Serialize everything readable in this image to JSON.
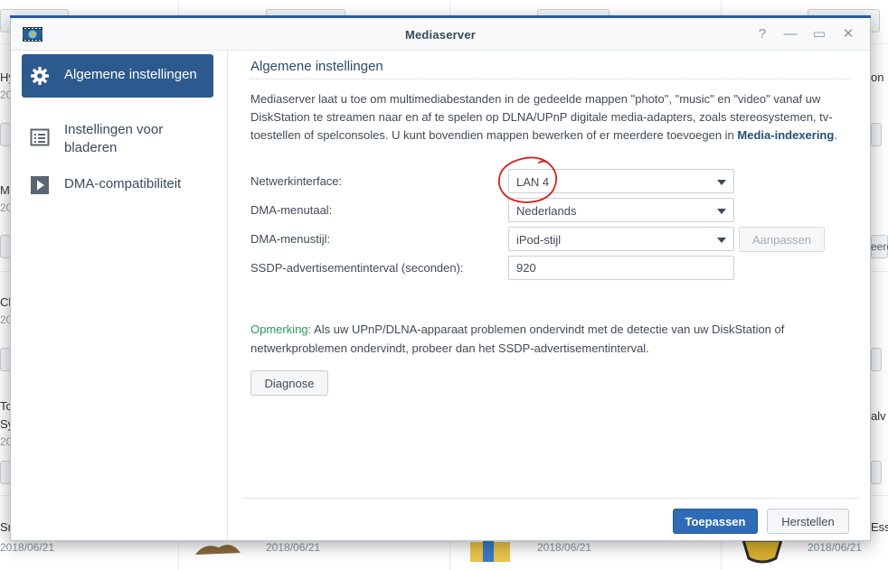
{
  "background": {
    "fragments": [
      "Hy",
      "20",
      "Ma",
      "20",
      "Clo",
      "20",
      "To",
      "Sy",
      "20",
      "Sn",
      "on",
      "alv"
    ],
    "dates": [
      "2018/06/21",
      "2018/06/21",
      "2018/06/21",
      "2018/06/21"
    ],
    "button_texts": [
      "eere"
    ]
  },
  "window": {
    "title": "Mediaserver",
    "controls": {
      "help": "?",
      "minimize": "—",
      "maximize": "▭",
      "close": "✕"
    }
  },
  "sidebar": {
    "items": [
      {
        "label": "Algemene instellingen",
        "icon": "gear-icon",
        "active": true
      },
      {
        "label": "Instellingen voor bladeren",
        "icon": "browse-list-icon",
        "active": false
      },
      {
        "label": "DMA-compatibiliteit",
        "icon": "play-icon",
        "active": false
      }
    ]
  },
  "main": {
    "section_title": "Algemene instellingen",
    "description_prefix": "Mediaserver laat u toe om multimediabestanden in de gedeelde mappen \"photo\", \"music\" en \"video\" vanaf uw DiskStation te streamen naar en af te spelen op DLNA/UPnP digitale media-adapters, zoals stereosystemen, tv-toestellen of spelconsoles. U kunt bovendien mappen bewerken of er meerdere toevoegen in ",
    "description_link": "Media-indexering",
    "description_suffix": ".",
    "fields": {
      "network_interface": {
        "label": "Netwerkinterface:",
        "value": "LAN 4"
      },
      "dma_language": {
        "label": "DMA-menutaal:",
        "value": "Nederlands"
      },
      "dma_style": {
        "label": "DMA-menustijl:",
        "value": "iPod-stijl"
      },
      "ssdp_interval": {
        "label": "SSDP-advertisementinterval (seconden):",
        "value": "920"
      }
    },
    "customize_button": "Aanpassen",
    "note_label": "Opmerking:",
    "note_text": " Als uw UPnP/DLNA-apparaat problemen ondervindt met de detectie van uw DiskStation of netwerkproblemen ondervindt, probeer dan het SSDP-advertisementinterval.",
    "diagnose_button": "Diagnose"
  },
  "footer": {
    "apply_button": "Toepassen",
    "reset_button": "Herstellen"
  },
  "colors": {
    "accent": "#2d5a8e",
    "primary_button": "#2f6cb7",
    "note_label": "#2a9a5a",
    "annotation": "#d92020"
  }
}
